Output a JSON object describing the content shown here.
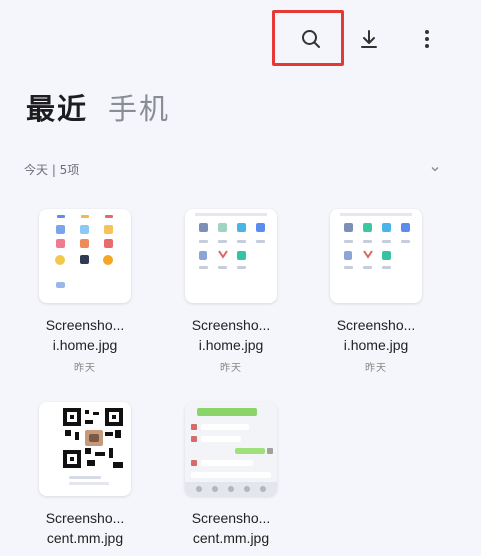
{
  "toolbar": {
    "icons": [
      "search-icon",
      "download-icon",
      "more-vertical-icon"
    ],
    "highlight_color": "#e53935"
  },
  "tabs": [
    {
      "label": "最近",
      "active": true
    },
    {
      "label": "手机",
      "active": false
    }
  ],
  "section": {
    "label": "今天 | 5项"
  },
  "files": [
    {
      "name_line1": "Screensho...",
      "name_line2": "i.home.jpg",
      "meta": "昨天",
      "thumb": "home-screen"
    },
    {
      "name_line1": "Screensho...",
      "name_line2": "i.home.jpg",
      "meta": "昨天",
      "thumb": "home-screen"
    },
    {
      "name_line1": "Screensho...",
      "name_line2": "i.home.jpg",
      "meta": "昨天",
      "thumb": "home-screen"
    },
    {
      "name_line1": "Screensho...",
      "name_line2": "cent.mm.jpg",
      "meta": "",
      "thumb": "qr-code"
    },
    {
      "name_line1": "Screensho...",
      "name_line2": "cent.mm.jpg",
      "meta": "",
      "thumb": "chat"
    }
  ]
}
